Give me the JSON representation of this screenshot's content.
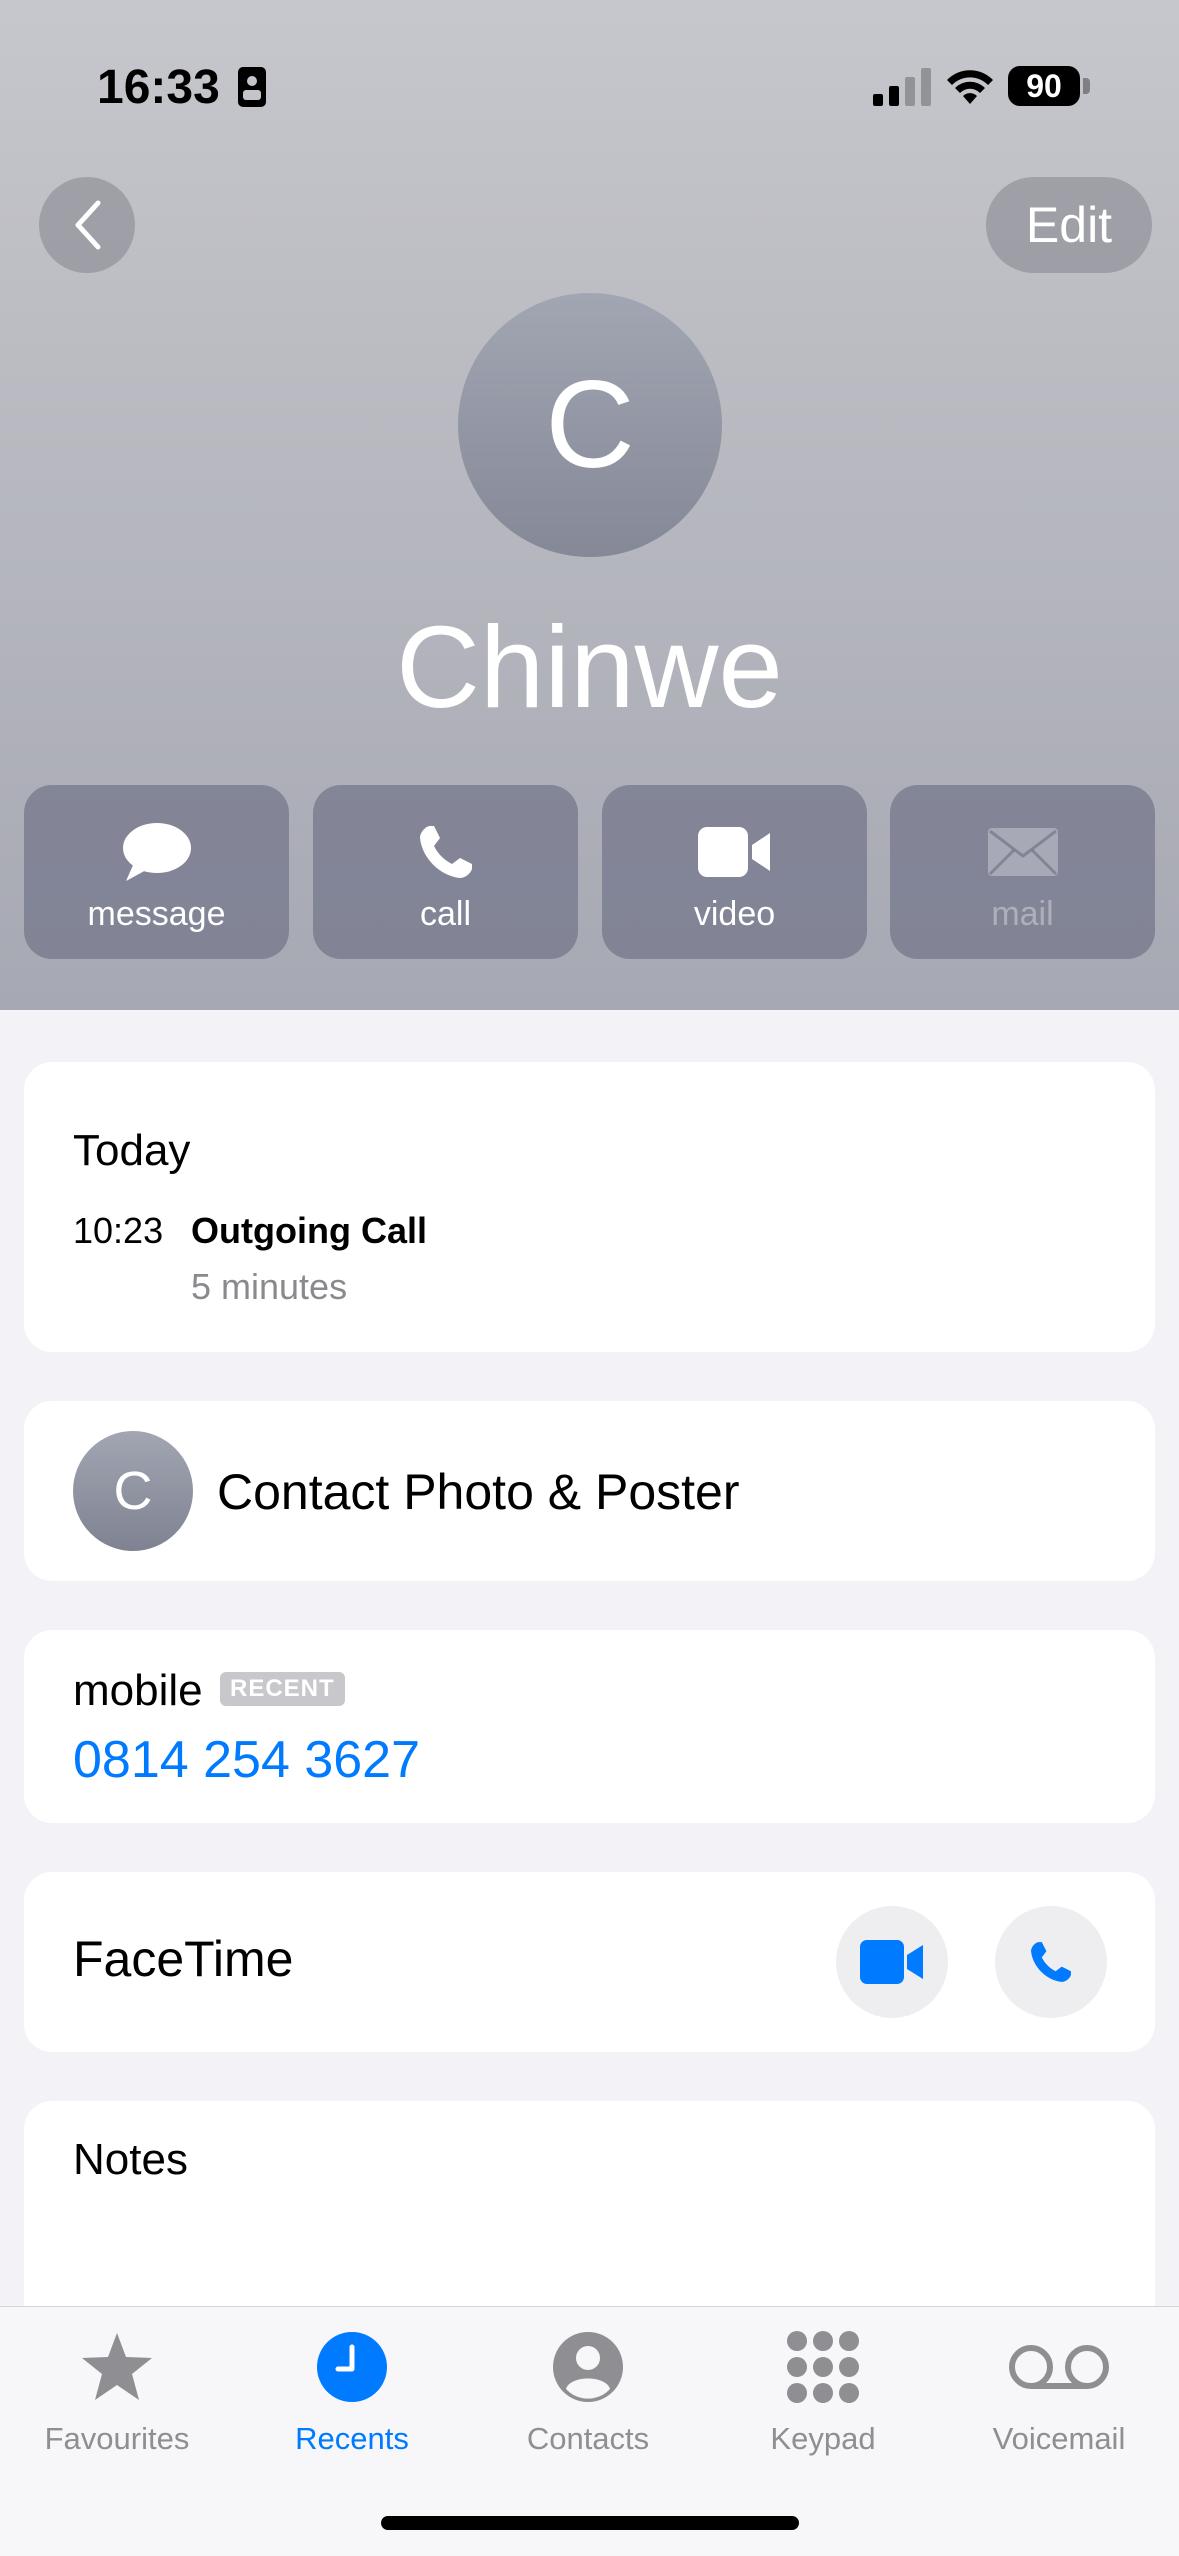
{
  "status_bar": {
    "time": "16:33",
    "battery": "90"
  },
  "nav": {
    "edit_label": "Edit"
  },
  "contact": {
    "initial": "C",
    "name": "Chinwe"
  },
  "actions": [
    {
      "label": "message",
      "icon": "message-bubble-icon",
      "enabled": true
    },
    {
      "label": "call",
      "icon": "phone-icon",
      "enabled": true
    },
    {
      "label": "video",
      "icon": "video-camera-icon",
      "enabled": true
    },
    {
      "label": "mail",
      "icon": "envelope-icon",
      "enabled": false
    }
  ],
  "recent_call": {
    "day": "Today",
    "time": "10:23",
    "type": "Outgoing Call",
    "duration": "5 minutes"
  },
  "poster": {
    "initial": "C",
    "label": "Contact Photo & Poster"
  },
  "phone": {
    "label": "mobile",
    "badge": "RECENT",
    "number": "0814 254 3627"
  },
  "facetime": {
    "label": "FaceTime"
  },
  "notes": {
    "label": "Notes"
  },
  "tabs": [
    {
      "label": "Favourites",
      "icon": "star-icon",
      "active": false
    },
    {
      "label": "Recents",
      "icon": "clock-icon",
      "active": true
    },
    {
      "label": "Contacts",
      "icon": "person-circle-icon",
      "active": false
    },
    {
      "label": "Keypad",
      "icon": "keypad-icon",
      "active": false
    },
    {
      "label": "Voicemail",
      "icon": "voicemail-icon",
      "active": false
    }
  ],
  "colors": {
    "accent": "#007aff",
    "header_gradient_top": "#c6c7cc",
    "header_gradient_bottom": "#a6a8b3"
  }
}
